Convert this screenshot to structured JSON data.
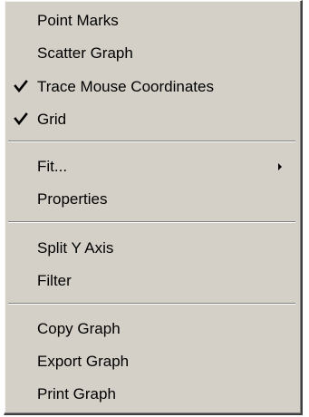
{
  "menu": {
    "items": [
      {
        "label": "Point Marks",
        "checked": false
      },
      {
        "label": "Scatter Graph",
        "checked": false
      },
      {
        "label": "Trace Mouse Coordinates",
        "checked": true,
        "check_icon": "checkmark-icon"
      },
      {
        "label": "Grid",
        "checked": true,
        "check_icon": "checkmark-icon"
      },
      {
        "label": "Fit...",
        "checked": false,
        "submenu_icon": "submenu-arrow-icon"
      },
      {
        "label": "Properties",
        "checked": false
      },
      {
        "label": "Split Y Axis",
        "checked": false
      },
      {
        "label": "Filter",
        "checked": false
      },
      {
        "label": "Copy Graph",
        "checked": false
      },
      {
        "label": "Export Graph",
        "checked": false
      },
      {
        "label": "Print Graph",
        "checked": false
      }
    ],
    "colors": {
      "background": "#d4d0c8",
      "text": "#000000",
      "separator_dark": "#808080",
      "separator_light": "#ffffff"
    }
  }
}
